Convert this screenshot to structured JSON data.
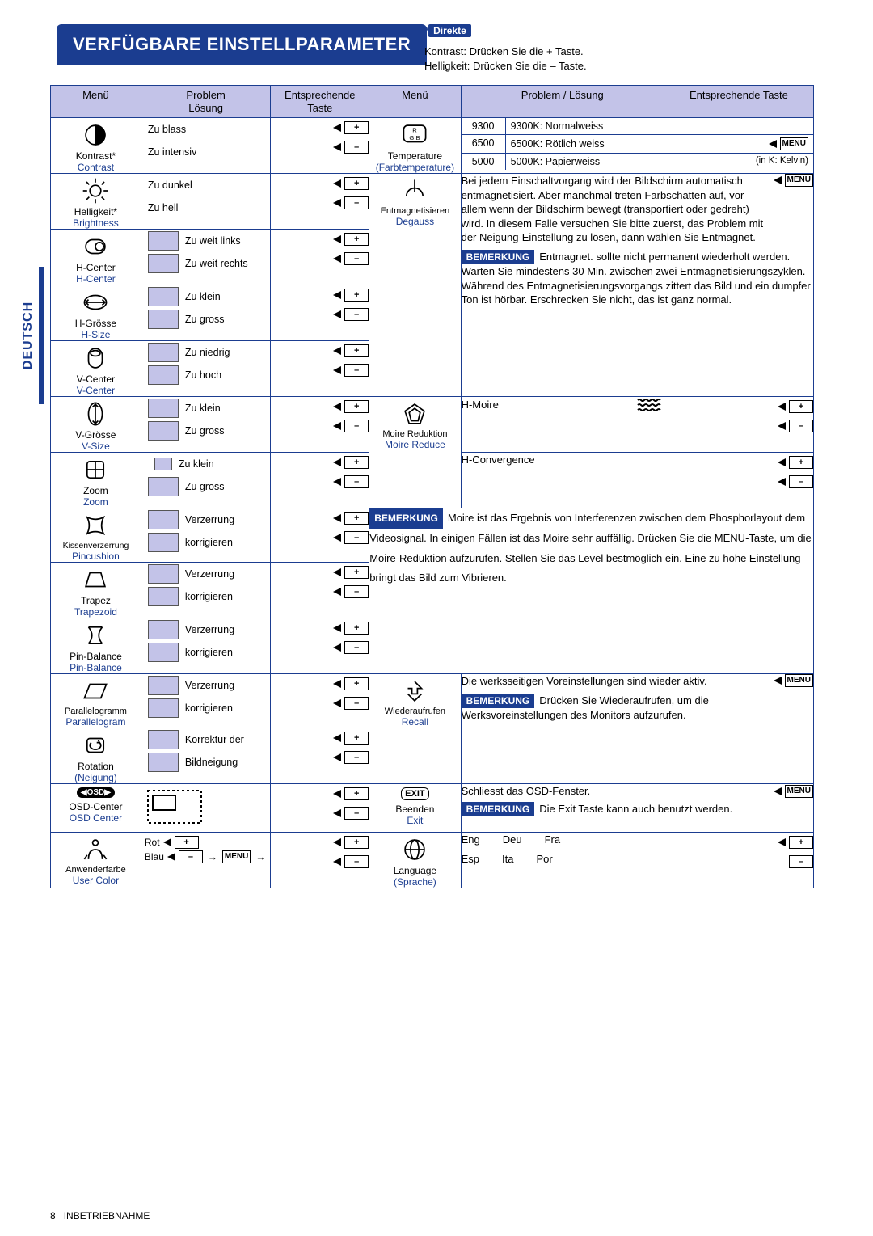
{
  "sideTab": "DEUTSCH",
  "title": "VERFÜGBARE EINSTELLPARAMETER",
  "direkte": {
    "label": "Direkte",
    "line1": "Kontrast:  Drücken Sie die + Taste.",
    "line2": "Helligkeit: Drücken Sie die – Taste."
  },
  "header": {
    "menu": "Menü",
    "prob": "Problem\nLösung",
    "key": "Entsprechende\nTaste",
    "menu2": "Menü",
    "prob2": "Problem / Lösung",
    "key2": "Entsprechende Taste"
  },
  "left": {
    "kontrast": {
      "de": "Kontrast*",
      "en": "Contrast",
      "p1": "Zu blass",
      "p2": "Zu intensiv"
    },
    "hellig": {
      "de": "Helligkeit*",
      "en": "Brightness",
      "p1": "Zu dunkel",
      "p2": "Zu hell"
    },
    "hcenter": {
      "de": "H-Center",
      "en": "H-Center",
      "p1": "Zu weit links",
      "p2": "Zu weit rechts"
    },
    "hsize": {
      "de": "H-Grösse",
      "en": "H-Size",
      "p1": "Zu klein",
      "p2": "Zu gross"
    },
    "vcenter": {
      "de": "V-Center",
      "en": "V-Center",
      "p1": "Zu niedrig",
      "p2": "Zu hoch"
    },
    "vsize": {
      "de": "V-Grösse",
      "en": "V-Size",
      "p1": "Zu klein",
      "p2": "Zu gross"
    },
    "zoom": {
      "de": "Zoom",
      "en": "Zoom",
      "p1": "Zu klein",
      "p2": "Zu gross"
    },
    "pin": {
      "de": "Kissenverzerrung",
      "en": "Pincushion",
      "p1": "Verzerrung",
      "p2": "korrigieren"
    },
    "trapez": {
      "de": "Trapez",
      "en": "Trapezoid",
      "p1": "Verzerrung",
      "p2": "korrigieren"
    },
    "pinbal": {
      "de": "Pin-Balance",
      "en": "Pin-Balance",
      "p1": "Verzerrung",
      "p2": "korrigieren"
    },
    "para": {
      "de": "Parallelogramm",
      "en": "Parallelogram",
      "p1": "Verzerrung",
      "p2": "korrigieren"
    },
    "rot": {
      "de": "Rotation",
      "en": "(Neigung)",
      "p1": "Korrektur der",
      "p2": "Bildneigung"
    },
    "osd": {
      "de": "OSD-Center",
      "en": "OSD Center",
      "badge": "OSD"
    },
    "user": {
      "de": "Anwenderfarbe",
      "en": "User Color",
      "rot": "Rot",
      "blau": "Blau",
      "menu": "MENU"
    }
  },
  "right": {
    "temp": {
      "de": "Temperature",
      "sub": "(Farbtemperature)",
      "r": "R",
      "gb": "G B",
      "rows": [
        {
          "k": "9300",
          "d": "9300K: Normalweiss"
        },
        {
          "k": "6500",
          "d": "6500K: Rötlich weiss"
        },
        {
          "k": "5000",
          "d": "5000K: Papierweiss"
        }
      ],
      "menu": "MENU",
      "kelvin": "(in K: Kelvin)"
    },
    "degauss": {
      "de": "Entmagnetisieren",
      "en": "Degauss",
      "t1": "Bei jedem Einschaltvorgang wird der Bildschirm automatisch entmagnetisiert. Aber manchmal treten Farbschatten auf, vor allem wenn der Bildschirm bewegt (transportiert oder gedreht) wird. In diesem Falle versuchen Sie bitte zuerst, das Problem mit der Neigung-Einstellung zu lösen, dann wählen Sie Entmagnet.",
      "note": "BEMERKUNG",
      "t2": "Entmagnet. sollte nicht permanent wiederholt werden. Warten Sie mindestens 30 Min. zwischen zwei Entmagnetisierungszyklen. Während des Entmagnetisierungsvorgangs zittert das Bild und ein dumpfer Ton ist hörbar. Erschrecken Sie nicht, das ist ganz normal.",
      "menu": "MENU"
    },
    "moire": {
      "de": "Moire Reduktion",
      "en": "Moire Reduce",
      "hmoire": "H-Moire",
      "hconv": "H-Convergence",
      "note": "BEMERKUNG",
      "t": "Moire ist das Ergebnis von Interferenzen zwischen dem Phosphorlayout dem Videosignal. In einigen Fällen ist das Moire sehr auffällig. Drücken Sie die MENU-Taste, um die Moire-Reduktion aufzurufen. Stellen Sie das Level bestmöglich ein. Eine zu hohe Einstellung bringt das Bild zum Vibrieren."
    },
    "recall": {
      "de": "Wiederaufrufen",
      "en": "Recall",
      "t1": "Die werksseitigen Voreinstellungen sind wieder aktiv.",
      "note": "BEMERKUNG",
      "t2": "Drücken Sie Wiederaufrufen, um die Werksvoreinstellungen des Monitors aufzurufen.",
      "menu": "MENU"
    },
    "exit": {
      "de": "Beenden",
      "en": "Exit",
      "badge": "EXIT",
      "t1": "Schliesst das OSD-Fenster.",
      "note": "BEMERKUNG",
      "t2": "Die Exit Taste kann auch benutzt werden.",
      "menu": "MENU"
    },
    "lang": {
      "de": "Language",
      "sub": "(Sprache)",
      "eng": "Eng",
      "deu": "Deu",
      "fra": "Fra",
      "esp": "Esp",
      "ita": "Ita",
      "por": "Por"
    }
  },
  "footer": {
    "page": "8",
    "label": "INBETRIEBNAHME"
  }
}
